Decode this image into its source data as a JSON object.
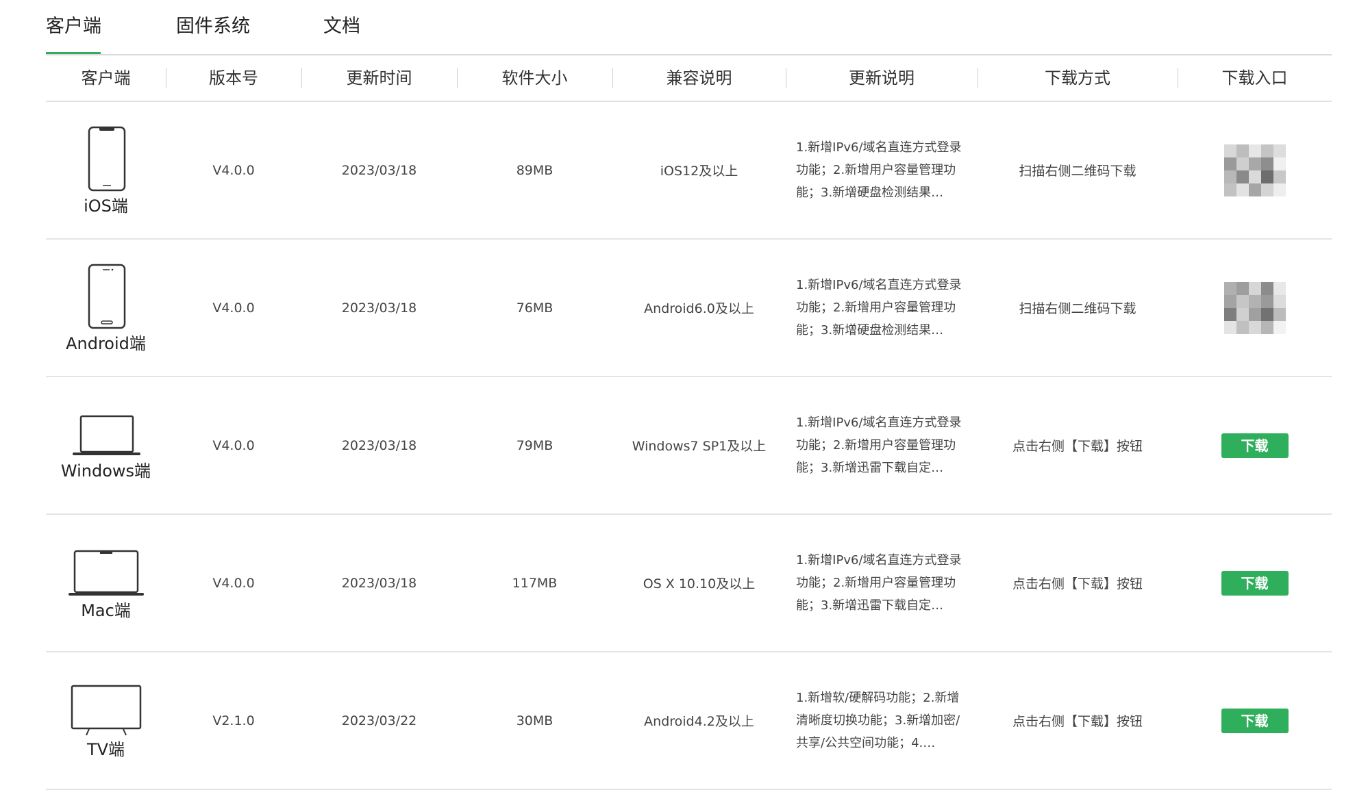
{
  "tabs": [
    {
      "label": "客户端",
      "active": true
    },
    {
      "label": "固件系统",
      "active": false
    },
    {
      "label": "文档",
      "active": false
    }
  ],
  "columns": [
    "客户端",
    "版本号",
    "更新时间",
    "软件大小",
    "兼容说明",
    "更新说明",
    "下载方式",
    "下载入口"
  ],
  "rows": [
    {
      "client": "iOS端",
      "icon": "iphone-icon",
      "version": "V4.0.0",
      "date": "2023/03/18",
      "size": "89MB",
      "compat": "iOS12及以上",
      "notes": "1.新增IPv6/域名直连方式登录功能；2.新增用户容量管理功能；3.新增硬盘检测结果…",
      "method": "扫描右侧二维码下载",
      "entry": "qr-code"
    },
    {
      "client": "Android端",
      "icon": "android-phone-icon",
      "version": "V4.0.0",
      "date": "2023/03/18",
      "size": "76MB",
      "compat": "Android6.0及以上",
      "notes": "1.新增IPv6/域名直连方式登录功能；2.新增用户容量管理功能；3.新增硬盘检测结果…",
      "method": "扫描右侧二维码下载",
      "entry": "qr-code"
    },
    {
      "client": "Windows端",
      "icon": "laptop-icon",
      "version": "V4.0.0",
      "date": "2023/03/18",
      "size": "79MB",
      "compat": "Windows7 SP1及以上",
      "notes": "1.新增IPv6/域名直连方式登录功能；2.新增用户容量管理功能；3.新增迅雷下载自定…",
      "method": "点击右侧【下载】按钮",
      "entry": "下载"
    },
    {
      "client": "Mac端",
      "icon": "macbook-icon",
      "version": "V4.0.0",
      "date": "2023/03/18",
      "size": "117MB",
      "compat": "OS X 10.10及以上",
      "notes": "1.新增IPv6/域名直连方式登录功能；2.新增用户容量管理功能；3.新增迅雷下载自定…",
      "method": "点击右侧【下载】按钮",
      "entry": "下载"
    },
    {
      "client": "TV端",
      "icon": "tv-icon",
      "version": "V2.1.0",
      "date": "2023/03/22",
      "size": "30MB",
      "compat": "Android4.2及以上",
      "notes": "1.新增软/硬解码功能；2.新增清晰度切换功能；3.新增加密/共享/公共空间功能；4.…",
      "method": "点击右侧【下载】按钮",
      "entry": "下载"
    }
  ],
  "colors": {
    "accent": "#2fae5b",
    "divider": "#e4e4e4"
  }
}
